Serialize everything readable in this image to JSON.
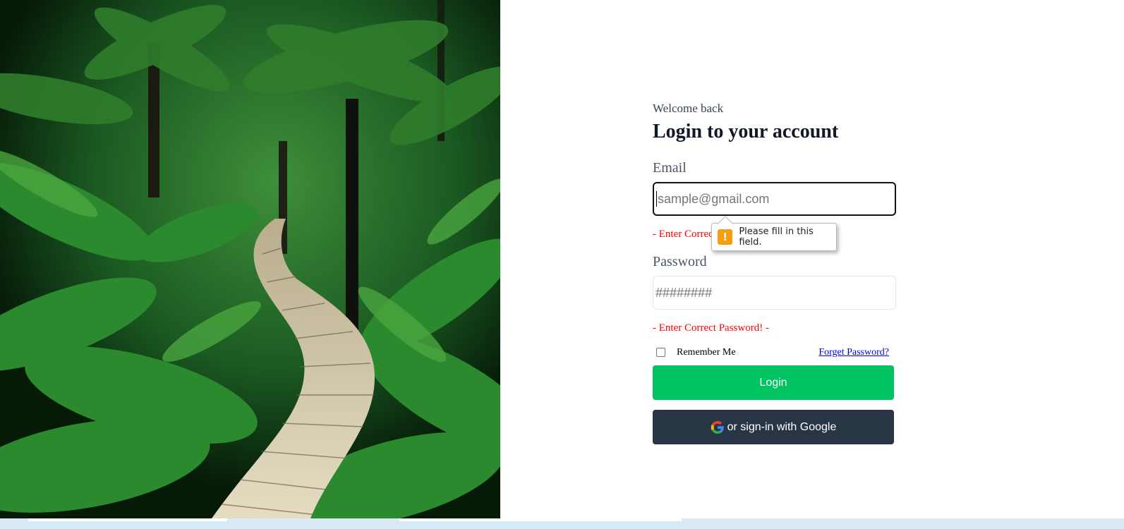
{
  "form": {
    "eyebrow": "Welcome back",
    "title": "Login to your account",
    "email_label": "Email",
    "email_placeholder": "sample@gmail.com",
    "email_error": "- Enter Correct Email! -",
    "password_label": "Password",
    "password_placeholder": "########",
    "password_error": "- Enter Correct Password! -",
    "remember_label": "Remember Me",
    "forget_link": "Forget Password?",
    "login_button": "Login",
    "google_button": "or sign-in with Google"
  },
  "tooltip": {
    "message": "Please fill in this field.",
    "icon": "warning-icon"
  },
  "hero": {
    "icon": "jungle-boardwalk-photo"
  },
  "colors": {
    "login_button": "#00c362",
    "google_button": "#283545",
    "error_text": "#ff0000",
    "link": "#0000ee",
    "warning": "#f59e0b"
  }
}
